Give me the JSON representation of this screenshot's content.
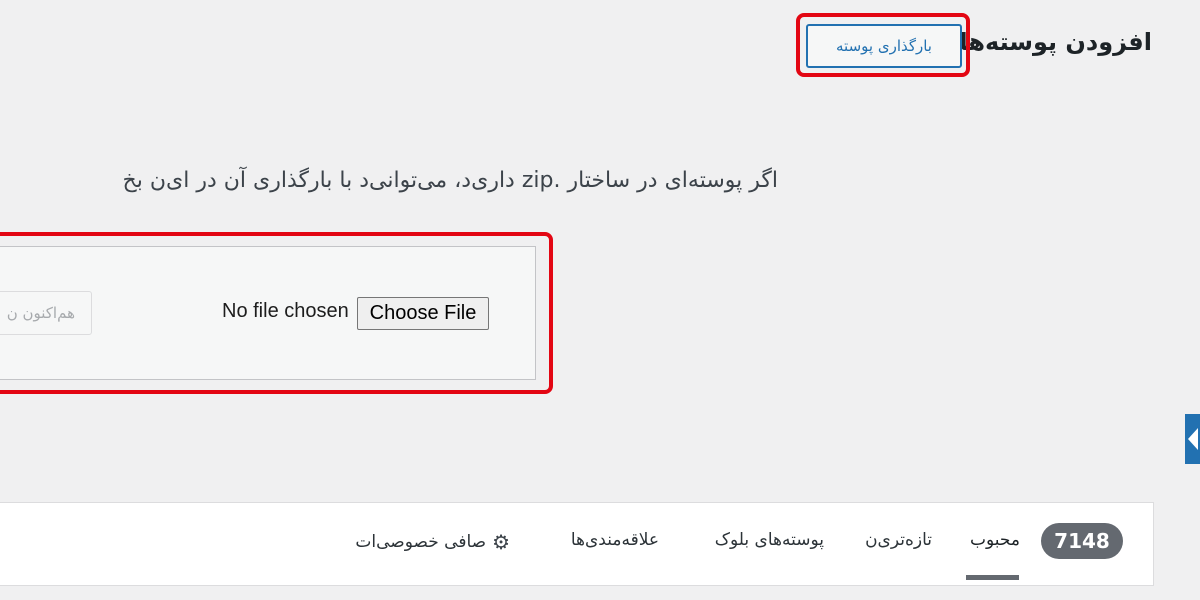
{
  "header": {
    "title": "افزودن پوسته‌ها",
    "upload_button": "بارگذاری پوسته"
  },
  "upload": {
    "description": "اگر پوسته‌ای در ساختار .zip داری‌د، می‌توانی‌د با بارگذاری آن در ای‌ن بخ",
    "install_button": "هم‌اکنون ن",
    "file_status": "No file chosen",
    "choose_file_button": "Choose File"
  },
  "filters": {
    "count": "7148",
    "tabs": [
      {
        "label": "محبوب",
        "active": true
      },
      {
        "label": "تازه‌تری‌ن",
        "active": false
      },
      {
        "label": "پوسته‌های بلوک",
        "active": false
      },
      {
        "label": "علاقه‌مندی‌ها",
        "active": false
      }
    ],
    "feature_filter": "صافی خصوصی‌ات"
  },
  "colors": {
    "highlight": "#e30613",
    "accent": "#2271b1",
    "badge": "#646970"
  },
  "icons": {
    "feature_filter_icon": "gear-icon",
    "collapse_arrow": "arrow-left-icon"
  }
}
